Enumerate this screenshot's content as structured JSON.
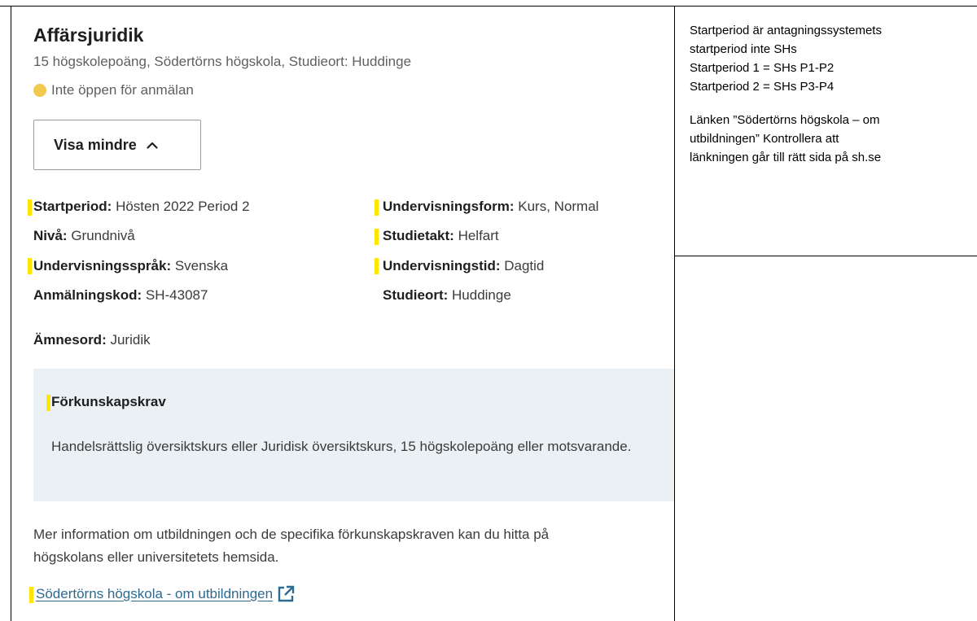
{
  "course": {
    "title": "Affärsjuridik",
    "subtitle": "15 högskolepoäng, Södertörns högskola, Studieort: Huddinge",
    "status": "Inte öppen för anmälan",
    "status_color": "#f2c94c"
  },
  "toggle_button": {
    "label": "Visa mindre",
    "icon": "chevron-up-icon"
  },
  "details": {
    "startperiod": {
      "label": "Startperiod:",
      "value": "Hösten 2022 Period 2"
    },
    "niva": {
      "label": "Nivå:",
      "value": "Grundnivå"
    },
    "sprak": {
      "label": "Undervisningsspråk:",
      "value": "Svenska"
    },
    "anmalningskod": {
      "label": "Anmälningskod:",
      "value": "SH-43087"
    },
    "undervisningsform": {
      "label": "Undervisningsform:",
      "value": "Kurs, Normal"
    },
    "studietakt": {
      "label": "Studietakt:",
      "value": "Helfart"
    },
    "undervisningstid": {
      "label": "Undervisningstid:",
      "value": "Dagtid"
    },
    "studieort": {
      "label": "Studieort:",
      "value": "Huddinge"
    },
    "amnesord": {
      "label": "Ämnesord:",
      "value": "Juridik"
    }
  },
  "requirements": {
    "title": "Förkunskapskrav",
    "text": "Handelsrättslig översiktskurs eller Juridisk översiktskurs, 15 högskolepoäng eller motsvarande."
  },
  "more_info": {
    "line1": "Mer information om utbildningen och de specifika förkunskapskraven kan du hitta på",
    "line2": "högskolans eller universitetets hemsida."
  },
  "link": {
    "label": "Södertörns högskola - om utbildningen",
    "icon": "external-link-icon",
    "color": "#2d6a8f"
  },
  "highlight_color": "#ffe600",
  "note": {
    "line1": "Startperiod är antagningssystemets",
    "line2": "startperiod inte SHs",
    "line3": "Startperiod 1 = SHs  P1-P2",
    "line4": "Startperiod 2 = SHs  P3-P4",
    "line5": "Länken ”Södertörns högskola – om",
    "line6": "utbildningen” Kontrollera att",
    "line7": "länkningen går till rätt sida på sh.se"
  }
}
